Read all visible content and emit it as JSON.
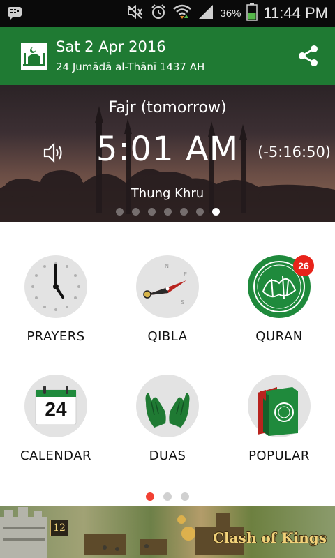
{
  "status_bar": {
    "battery_percent": "36%",
    "time": "11:44 PM",
    "icons": [
      "bbm-icon",
      "mute-icon",
      "alarm-icon",
      "wifi-icon",
      "signal-icon",
      "battery-icon"
    ]
  },
  "app_bar": {
    "title": "Sat 2 Apr 2016",
    "subtitle": "24 Jumādā al-Thānī 1437 AH",
    "share_icon": "share-icon",
    "logo_icon": "mosque-icon",
    "color": "#1f7a33"
  },
  "hero": {
    "prayer_name": "Fajr (tomorrow)",
    "prayer_time": "5:01 AM",
    "countdown": "(-5:16:50)",
    "location": "Thung Khru",
    "speaker_icon": "speaker-icon",
    "page_count": 7,
    "active_page": 6
  },
  "grid": {
    "prayers": "PRAYERS",
    "qibla": "QIBLA",
    "quran": "QURAN",
    "quran_badge": "26",
    "calendar": "CALENDAR",
    "calendar_day": "24",
    "duas": "DUAS",
    "popular": "POPULAR"
  },
  "pager": {
    "pages": 3,
    "active": 0,
    "active_color": "#f24033"
  },
  "ad": {
    "title": "Clash of Kings",
    "level": "12"
  }
}
